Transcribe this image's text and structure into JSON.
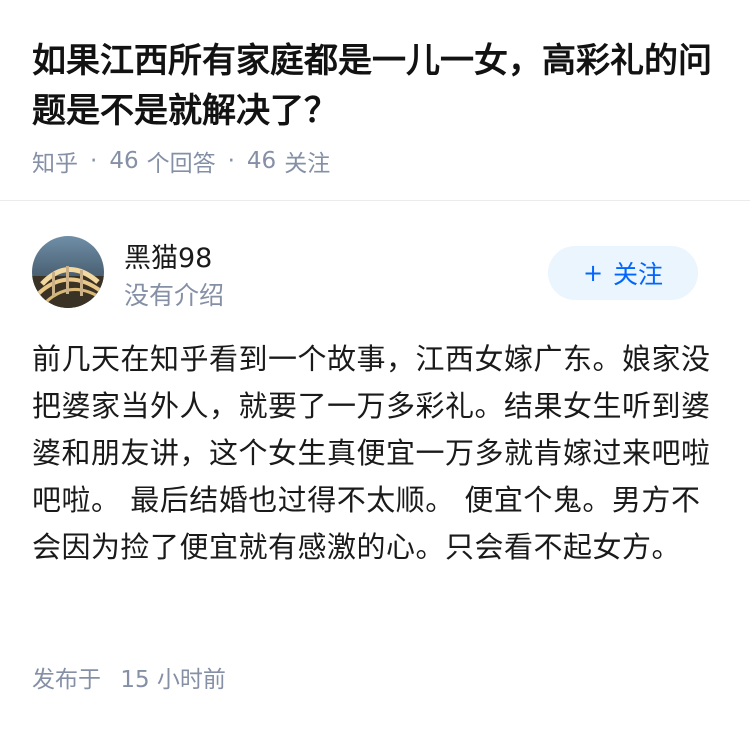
{
  "question": {
    "title": "如果江西所有家庭都是一儿一女，高彩礼的问题是不是就解决了？",
    "source": "知乎",
    "separator": "·",
    "answers_count": "46",
    "answers_label": "个回答",
    "followers_count": "46",
    "followers_label": "关注"
  },
  "author": {
    "name": "黑猫98",
    "bio": "没有介绍",
    "avatar_icon": "avatar-photo"
  },
  "follow_button": {
    "plus": "+",
    "label": "关注"
  },
  "answer": {
    "content": "前几天在知乎看到一个故事，江西女嫁广东。娘家没把婆家当外人，就要了一万多彩礼。结果女生听到婆婆和朋友讲，这个女生真便宜一万多就肯嫁过来吧啦吧啦。 最后结婚也过得不太顺。 便宜个鬼。男方不会因为捡了便宜就有感激的心。只会看不起女方。",
    "published_label": "发布于",
    "published_time": "15 小时前"
  }
}
